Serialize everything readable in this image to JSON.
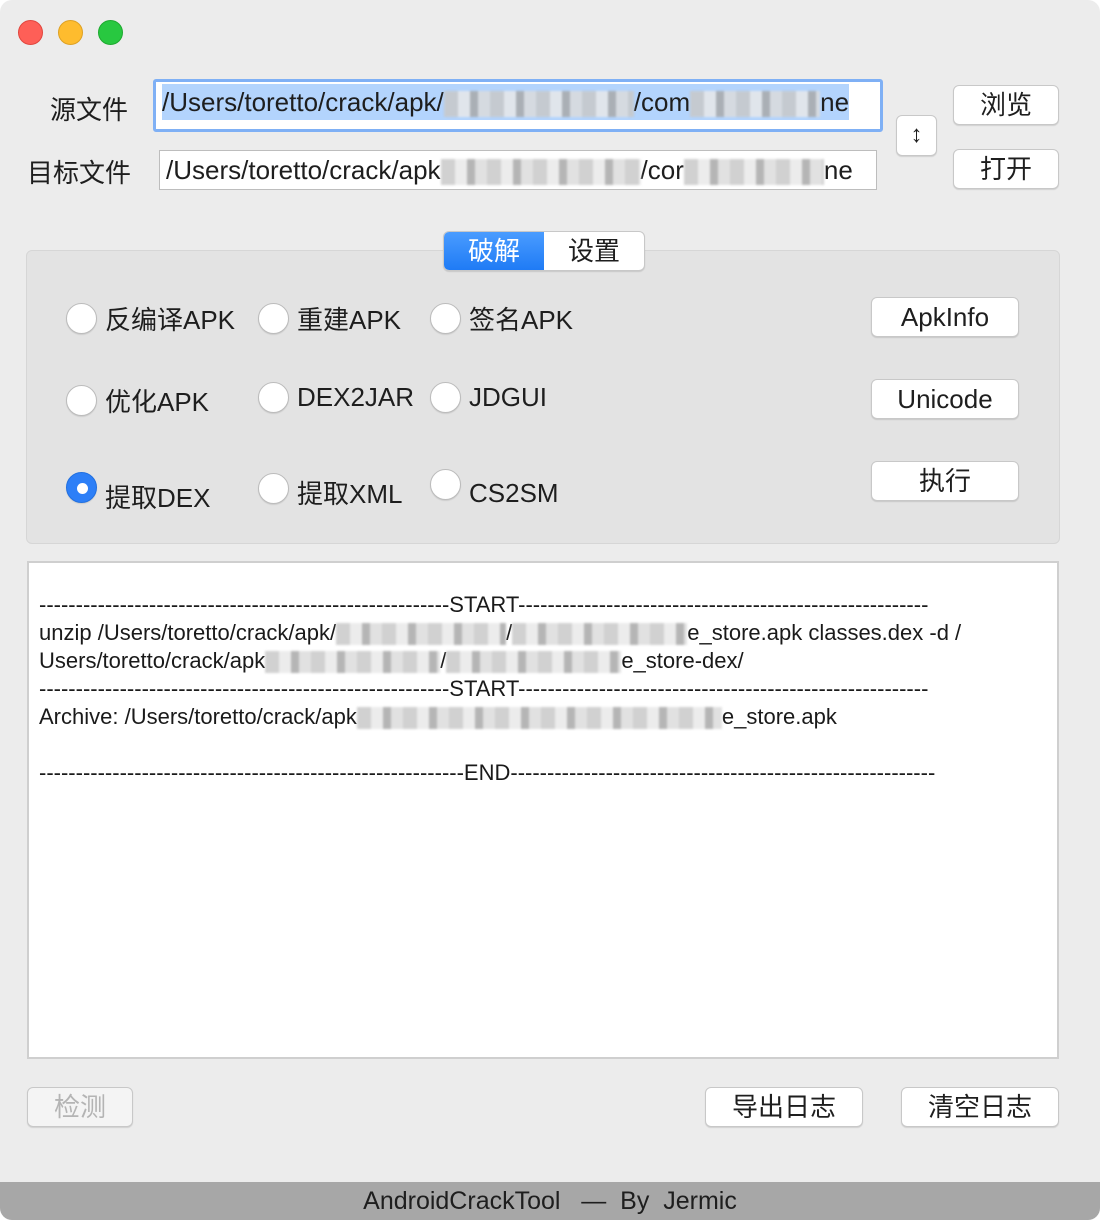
{
  "window": {
    "controls": [
      "close",
      "minimize",
      "zoom"
    ]
  },
  "files": {
    "source_label": "源文件",
    "source_path_prefix": "/Users/toretto/crack/apk/",
    "source_path_mid": "/com",
    "source_path_suffix": "ne",
    "target_label": "目标文件",
    "target_path_prefix": "/Users/toretto/crack/apk",
    "target_path_mid": "/cor",
    "target_path_suffix": "ne",
    "swap_icon": "↕",
    "browse_label": "浏览",
    "open_label": "打开"
  },
  "tabs": {
    "items": [
      "破解",
      "设置"
    ],
    "active": "破解"
  },
  "options": {
    "radios": [
      {
        "label": "反编译APK",
        "checked": false
      },
      {
        "label": "重建APK",
        "checked": false
      },
      {
        "label": "签名APK",
        "checked": false
      },
      {
        "label": "优化APK",
        "checked": false
      },
      {
        "label": "DEX2JAR",
        "checked": false
      },
      {
        "label": "JDGUI",
        "checked": false
      },
      {
        "label": "提取DEX",
        "checked": true
      },
      {
        "label": "提取XML",
        "checked": false
      },
      {
        "label": "CS2SM",
        "checked": false
      }
    ],
    "apkinfo_label": "ApkInfo",
    "unicode_label": "Unicode",
    "execute_label": "执行"
  },
  "log": {
    "line1": "--------------------------------------------------------START--------------------------------------------------------",
    "line2_a": "unzip  /Users/toretto/crack/apk/",
    "line2_b": "/",
    "line2_c": "e_store.apk classes.dex -d /",
    "line3_a": "Users/toretto/crack/apk",
    "line3_b": "/",
    "line3_c": "e_store-dex/",
    "line4": "--------------------------------------------------------START--------------------------------------------------------",
    "line5_a": "Archive:  /Users/toretto/crack/apk",
    "line5_c": "e_store.apk",
    "line7": "----------------------------------------------------------END----------------------------------------------------------"
  },
  "bottom": {
    "detect_label": "检测",
    "export_log_label": "导出日志",
    "clear_log_label": "清空日志"
  },
  "footer": {
    "text": "AndroidCrackTool   —  By  Jermic"
  }
}
